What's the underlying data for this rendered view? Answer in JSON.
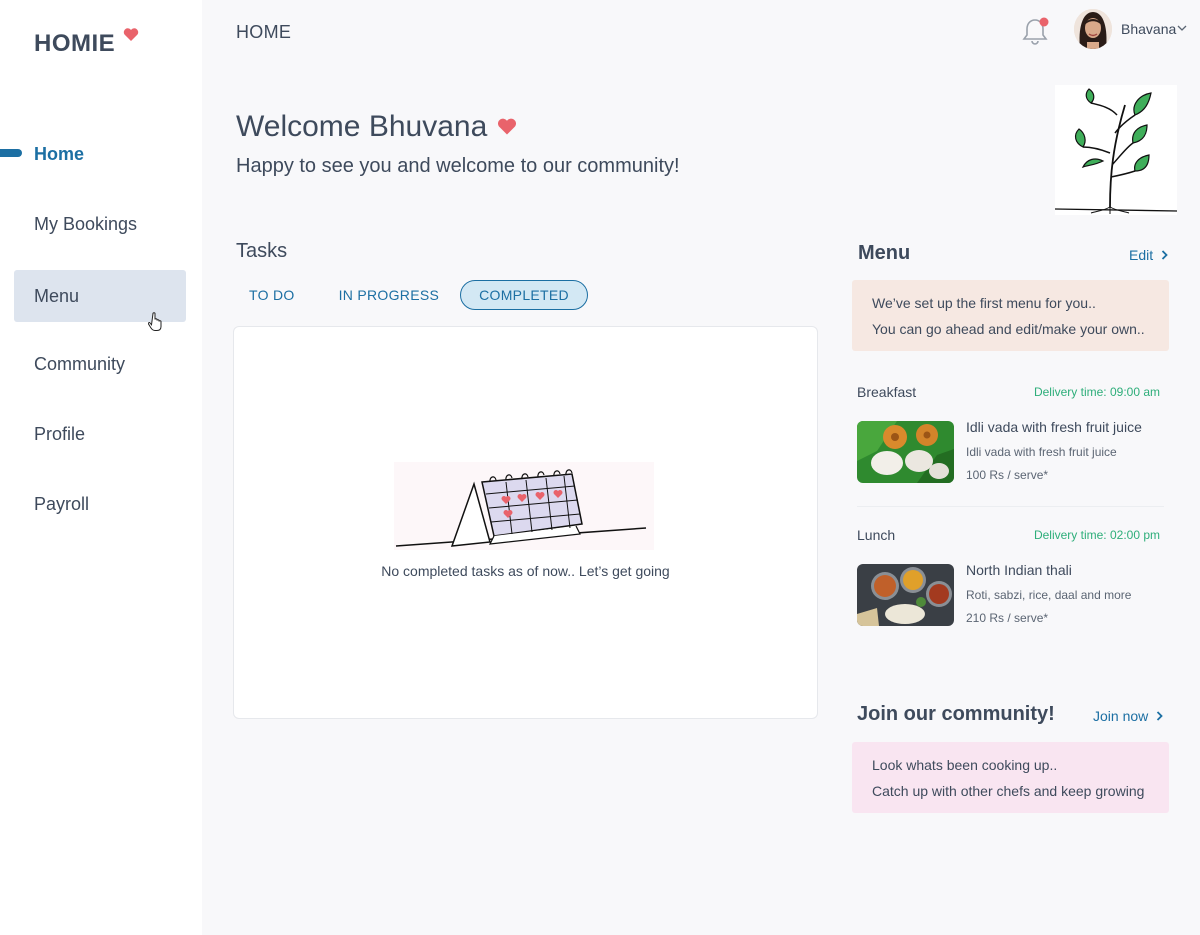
{
  "brand": {
    "name": "HOMIE"
  },
  "sidebar": {
    "items": [
      {
        "label": "Home",
        "state": "active"
      },
      {
        "label": "My Bookings",
        "state": "normal"
      },
      {
        "label": "Menu",
        "state": "hover"
      },
      {
        "label": "Community",
        "state": "normal"
      },
      {
        "label": "Profile",
        "state": "normal"
      },
      {
        "label": "Payroll",
        "state": "normal"
      }
    ]
  },
  "header": {
    "title": "HOME",
    "user_name": "Bhavana",
    "has_notification": true
  },
  "welcome": {
    "title": "Welcome Bhuvana",
    "subtitle": "Happy to see you and welcome to our community!"
  },
  "tasks": {
    "title": "Tasks",
    "tabs": [
      {
        "label": "TO DO",
        "selected": false
      },
      {
        "label": "IN PROGRESS",
        "selected": false
      },
      {
        "label": "COMPLETED",
        "selected": true
      }
    ],
    "empty_message": "No completed tasks as of now.. Let’s get going"
  },
  "menu": {
    "title": "Menu",
    "edit_label": "Edit",
    "note_line1": "We’ve set up the first menu for you..",
    "note_line2": "You can go ahead and edit/make your own..",
    "meals": [
      {
        "label": "Breakfast",
        "delivery": "Delivery time: 09:00 am",
        "dish": "Idli vada with fresh fruit juice",
        "description": "Idli vada with fresh fruit juice",
        "price": "100 Rs / serve*"
      },
      {
        "label": "Lunch",
        "delivery": "Delivery time: 02:00 pm",
        "dish": "North Indian thali",
        "description": "Roti, sabzi, rice, daal and more",
        "price": "210 Rs / serve*"
      }
    ]
  },
  "community": {
    "title": "Join our community!",
    "link_label": "Join now",
    "note_line1": "Look whats been cooking up..",
    "note_line2": "Catch up with other chefs and keep growing"
  },
  "colors": {
    "accent": "#1c6fa3",
    "heart": "#e9636b",
    "delivery_green": "#2eae7a",
    "menu_note_bg": "#f6e8e2",
    "community_note_bg": "#f9e5f1"
  }
}
